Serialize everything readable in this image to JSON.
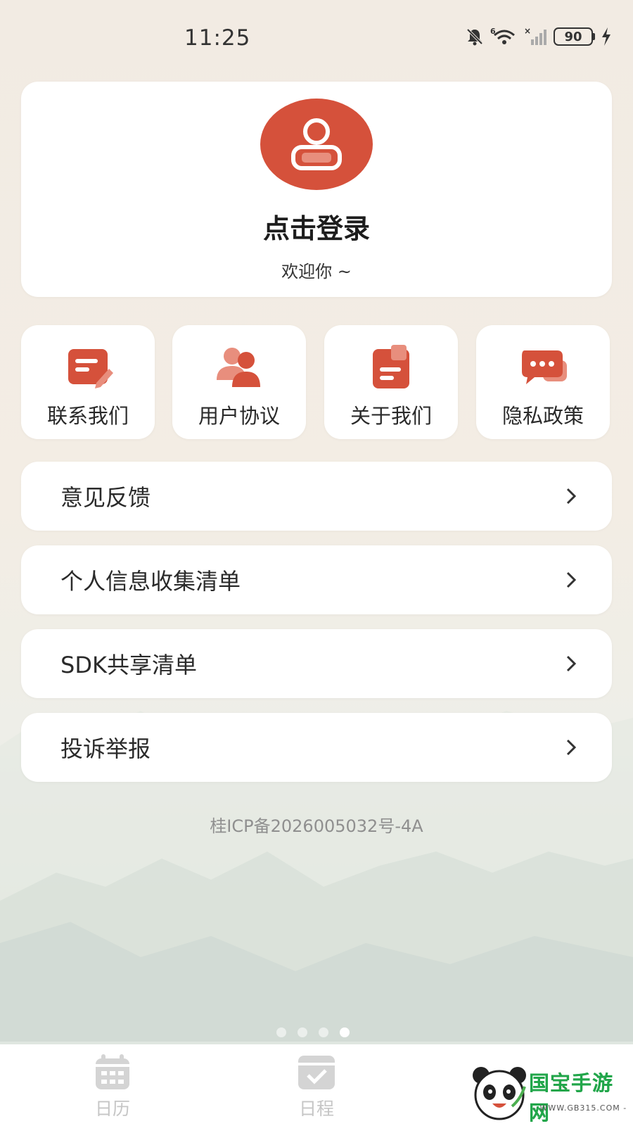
{
  "status_bar": {
    "time": "11:25",
    "network_label": "6",
    "battery_level": "90"
  },
  "profile": {
    "login_title": "点击登录",
    "welcome_text": "欢迎你 ~"
  },
  "quick_links": [
    {
      "label": "联系我们",
      "icon": "edit-note-icon"
    },
    {
      "label": "用户协议",
      "icon": "users-icon"
    },
    {
      "label": "关于我们",
      "icon": "document-icon"
    },
    {
      "label": "隐私政策",
      "icon": "chat-bubble-icon"
    }
  ],
  "menu": [
    {
      "label": "意见反馈"
    },
    {
      "label": "个人信息收集清单"
    },
    {
      "label": "SDK共享清单"
    },
    {
      "label": "投诉举报"
    }
  ],
  "icp_text": "桂ICP备2026005032号-4A",
  "pager": {
    "count": 4,
    "active_index": 3
  },
  "bottom_nav": [
    {
      "label": "日历",
      "icon": "calendar-icon"
    },
    {
      "label": "日程",
      "icon": "schedule-check-icon"
    }
  ],
  "watermark": {
    "brand": "国宝手游网",
    "url": "- WWW.GB315.COM -"
  },
  "colors": {
    "accent": "#d5513b",
    "accent_light": "#e88e7d",
    "inactive_tab": "#c6c6c6"
  }
}
